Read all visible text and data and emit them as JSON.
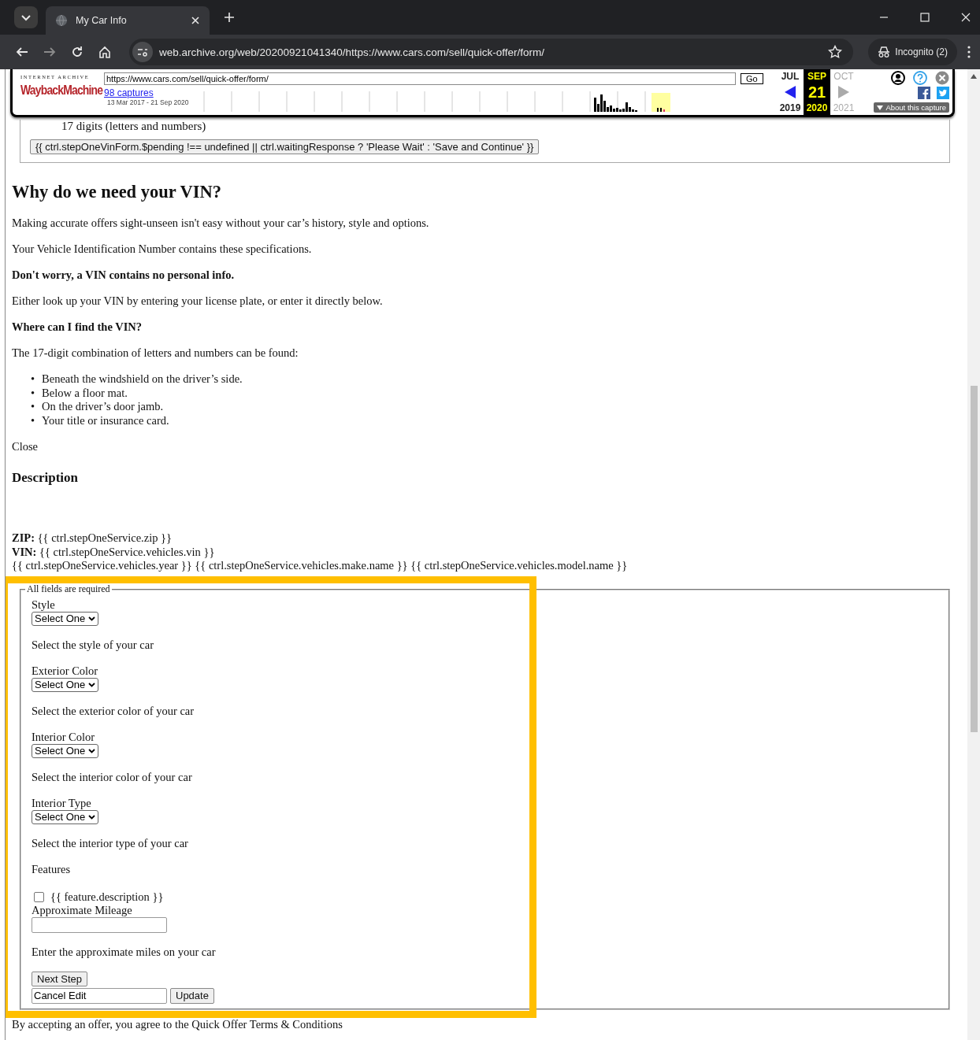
{
  "browser": {
    "tab_title": "My Car Info",
    "url": "web.archive.org/web/20200921041340/https://www.cars.com/sell/quick-offer/form/",
    "profile": "Incognito (2)"
  },
  "wayback": {
    "logo_top": "INTERNET ARCHIVE",
    "logo": "WaybackMachine",
    "url_field": "https://www.cars.com/sell/quick-offer/form/",
    "go": "Go",
    "captures": "98 captures",
    "date_range": "13 Mar 2017 - 21 Sep 2020",
    "about": "About this capture",
    "months": [
      {
        "month": "JUL",
        "year": "2019",
        "selected": false
      },
      {
        "month": "SEP",
        "day": "21",
        "year": "2020",
        "selected": true
      },
      {
        "month": "OCT",
        "year": "2021",
        "selected": false
      }
    ]
  },
  "vin_form": {
    "hint": "17 digits (letters and numbers)",
    "button": "{{ ctrl.stepOneVinForm.$pending !== undefined || ctrl.waitingResponse ? 'Please Wait' : 'Save and Continue' }}"
  },
  "info": {
    "heading": "Why do we need your VIN?",
    "blocks": [
      {
        "kind": "text",
        "text": "Making accurate offers sight-unseen isn't easy without your car’s history, style and options."
      },
      {
        "kind": "text",
        "text": "Your Vehicle Identification Number contains these specifications."
      },
      {
        "kind": "strong",
        "text": "Don't worry, a VIN contains no personal info."
      },
      {
        "kind": "text",
        "text": "Either look up your VIN by entering your license plate, or enter it directly below."
      },
      {
        "kind": "strong",
        "text": "Where can I find the VIN?"
      },
      {
        "kind": "text",
        "text": "The 17-digit combination of letters and numbers can be found:"
      },
      {
        "kind": "list",
        "bullet": "•",
        "items": [
          "Beneath the windshield on the driver’s side.",
          "Below a floor mat.",
          "On the driver’s door jamb.",
          "Your title or insurance card."
        ]
      },
      {
        "kind": "text",
        "text": "Close"
      }
    ],
    "description": "Description"
  },
  "summary": [
    "**ZIP:** {{ ctrl.stepOneService.zip }}",
    "**VIN:** {{ ctrl.stepOneService.vehicles.vin }}",
    "{{ ctrl.stepOneService.vehicles.year }} {{ ctrl.stepOneService.vehicles.make.name }} {{ ctrl.stepOneService.vehicles.model.name }}"
  ],
  "form": {
    "legend": "All fields are required",
    "fields": [
      {
        "kind": "select",
        "label": "Style",
        "value": "Select One",
        "help": "Select the style of your car"
      },
      {
        "kind": "select",
        "label": "Exterior Color",
        "value": "Select One",
        "help": "Select the exterior color of your car"
      },
      {
        "kind": "select",
        "label": "Interior Color",
        "value": "Select One",
        "help": "Select the interior color of your car"
      },
      {
        "kind": "select",
        "label": "Interior Type",
        "value": "Select One",
        "help": "Select the interior type of your car"
      },
      {
        "kind": "checkboxes",
        "label": "Features",
        "options": [
          {
            "text": "{{ feature.description }}",
            "checked": false
          }
        ]
      },
      {
        "kind": "text",
        "label": "Approximate Mileage",
        "help": "Enter the approximate miles on your car"
      }
    ],
    "next": "Next Step",
    "cancel_value": "Cancel Edit",
    "update": "Update"
  },
  "footer_text": "By accepting an offer, you agree to the Quick Offer Terms & Conditions"
}
